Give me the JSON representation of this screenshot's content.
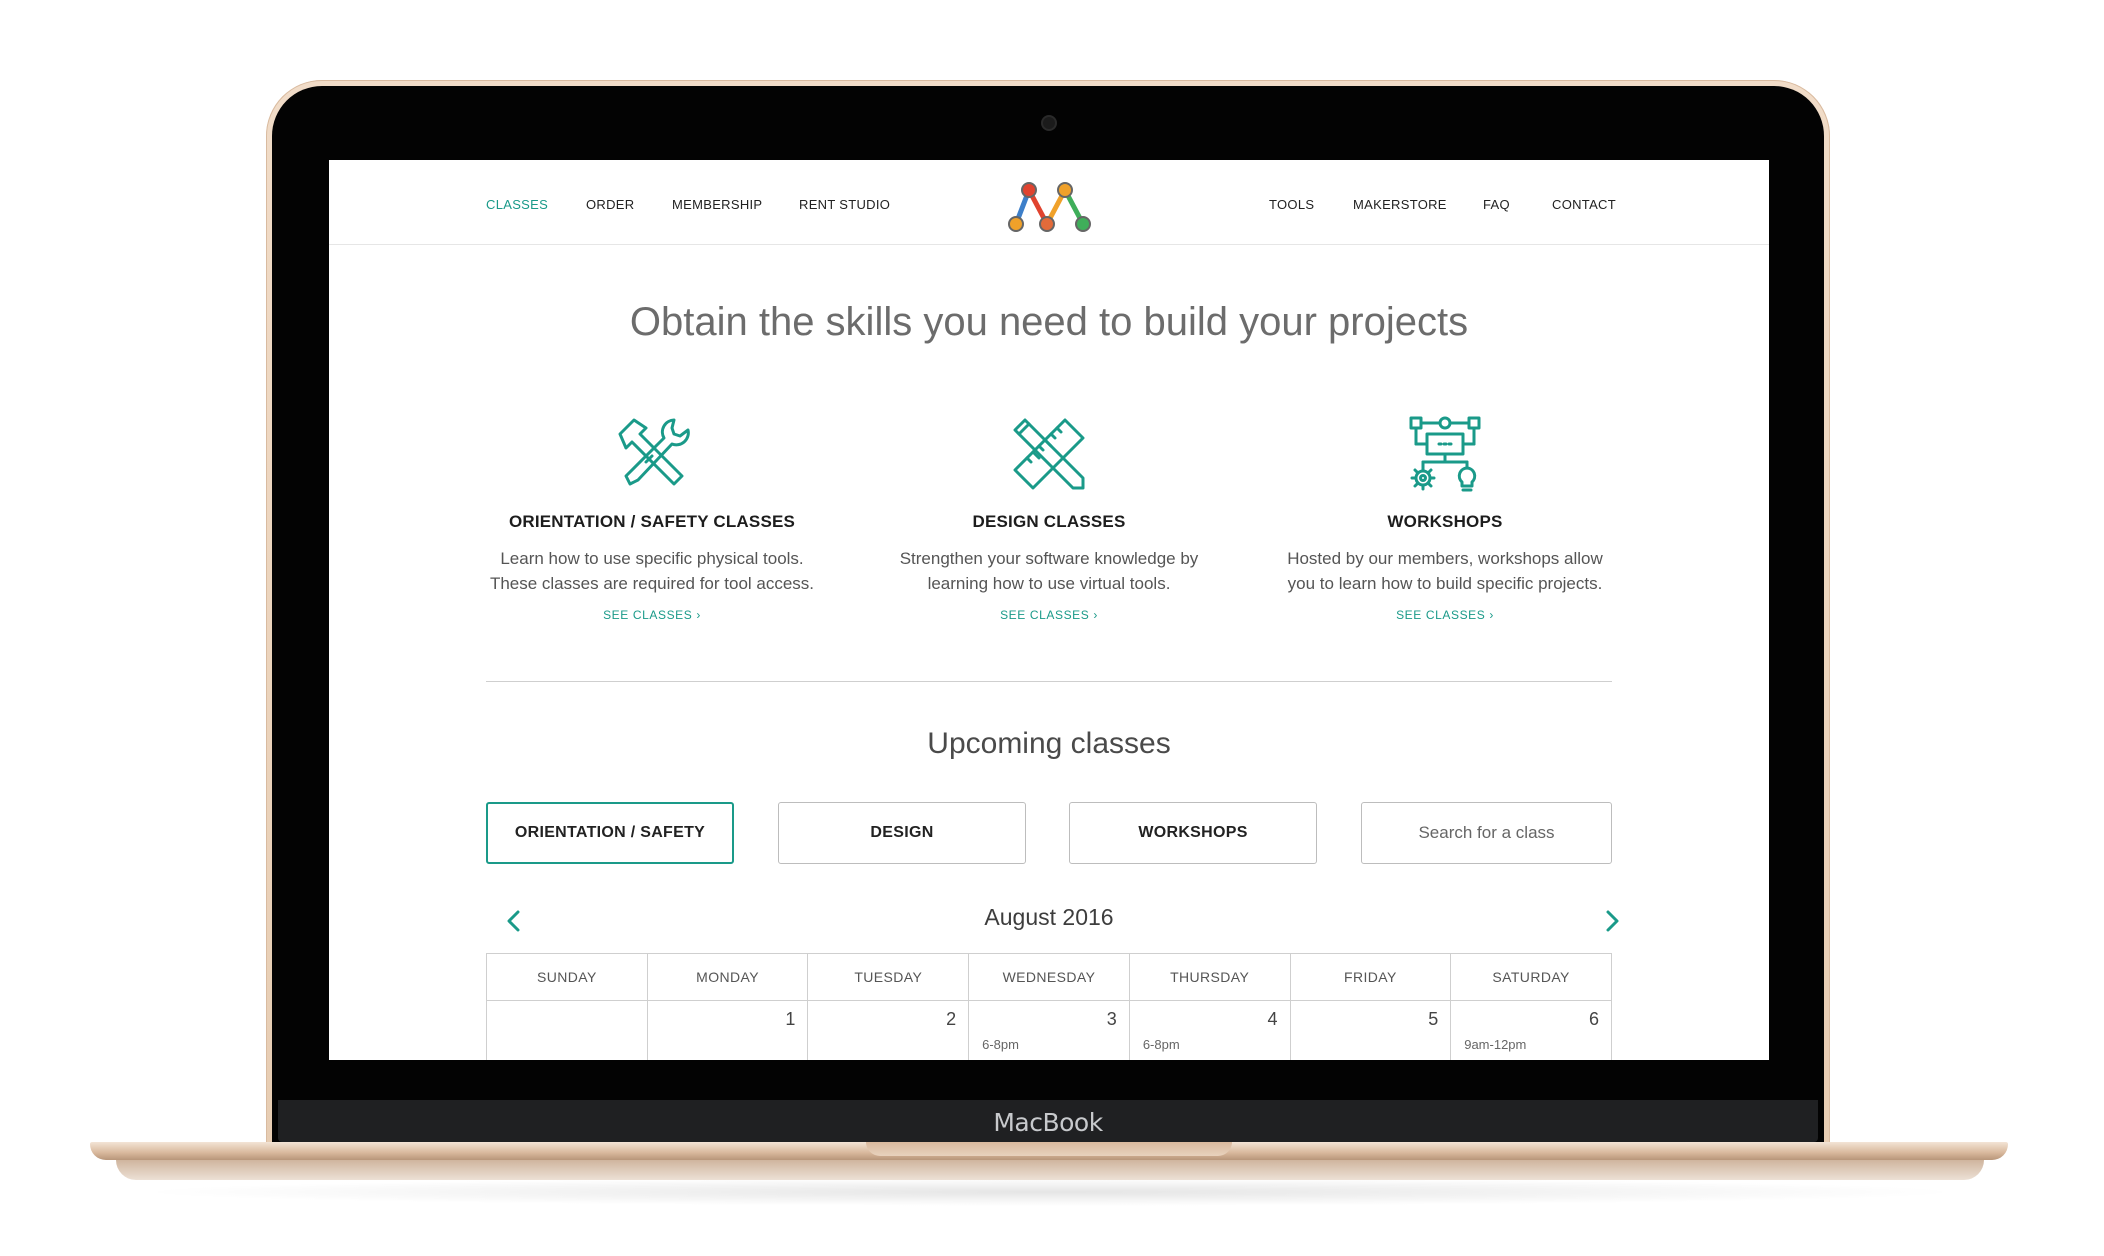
{
  "device": {
    "label": "MacBook"
  },
  "nav": {
    "left": [
      "CLASSES",
      "ORDER",
      "MEMBERSHIP",
      "RENT STUDIO"
    ],
    "right": [
      "TOOLS",
      "MAKERSTORE",
      "FAQ",
      "CONTACT"
    ],
    "active": "CLASSES",
    "logo_icon": "maker-m-logo-icon"
  },
  "hero": {
    "title": "Obtain the skills you need to build your projects"
  },
  "features": [
    {
      "icon": "hammer-wrench-icon",
      "title": "ORIENTATION / SAFETY CLASSES",
      "desc_line1": "Learn how to use specific physical tools.",
      "desc_line2": "These classes are required for tool access.",
      "link": "SEE CLASSES ›"
    },
    {
      "icon": "pencil-ruler-icon",
      "title": "DESIGN CLASSES",
      "desc_line1": "Strengthen your software knowledge by",
      "desc_line2": "learning how to use virtual tools.",
      "link": "SEE CLASSES ›"
    },
    {
      "icon": "workflow-gear-bulb-icon",
      "title": "WORKSHOPS",
      "desc_line1": "Hosted by our members, workshops allow",
      "desc_line2": "you to learn how to build specific projects.",
      "link": "SEE CLASSES ›"
    }
  ],
  "upcoming": {
    "title": "Upcoming classes",
    "filters": [
      "ORIENTATION / SAFETY",
      "DESIGN",
      "WORKSHOPS"
    ],
    "active_filter": "ORIENTATION / SAFETY",
    "search_placeholder": "Search for a class"
  },
  "calendar": {
    "month": "August 2016",
    "weekdays": [
      "SUNDAY",
      "MONDAY",
      "TUESDAY",
      "WEDNESDAY",
      "THURSDAY",
      "FRIDAY",
      "SATURDAY"
    ],
    "first_week": [
      {
        "day": "",
        "time": ""
      },
      {
        "day": "1",
        "time": ""
      },
      {
        "day": "2",
        "time": ""
      },
      {
        "day": "3",
        "time": "6-8pm"
      },
      {
        "day": "4",
        "time": "6-8pm"
      },
      {
        "day": "5",
        "time": ""
      },
      {
        "day": "6",
        "time": "9am-12pm"
      }
    ]
  },
  "colors": {
    "accent": "#1a9a89",
    "text": "#333333",
    "border": "#cfcfcf"
  }
}
